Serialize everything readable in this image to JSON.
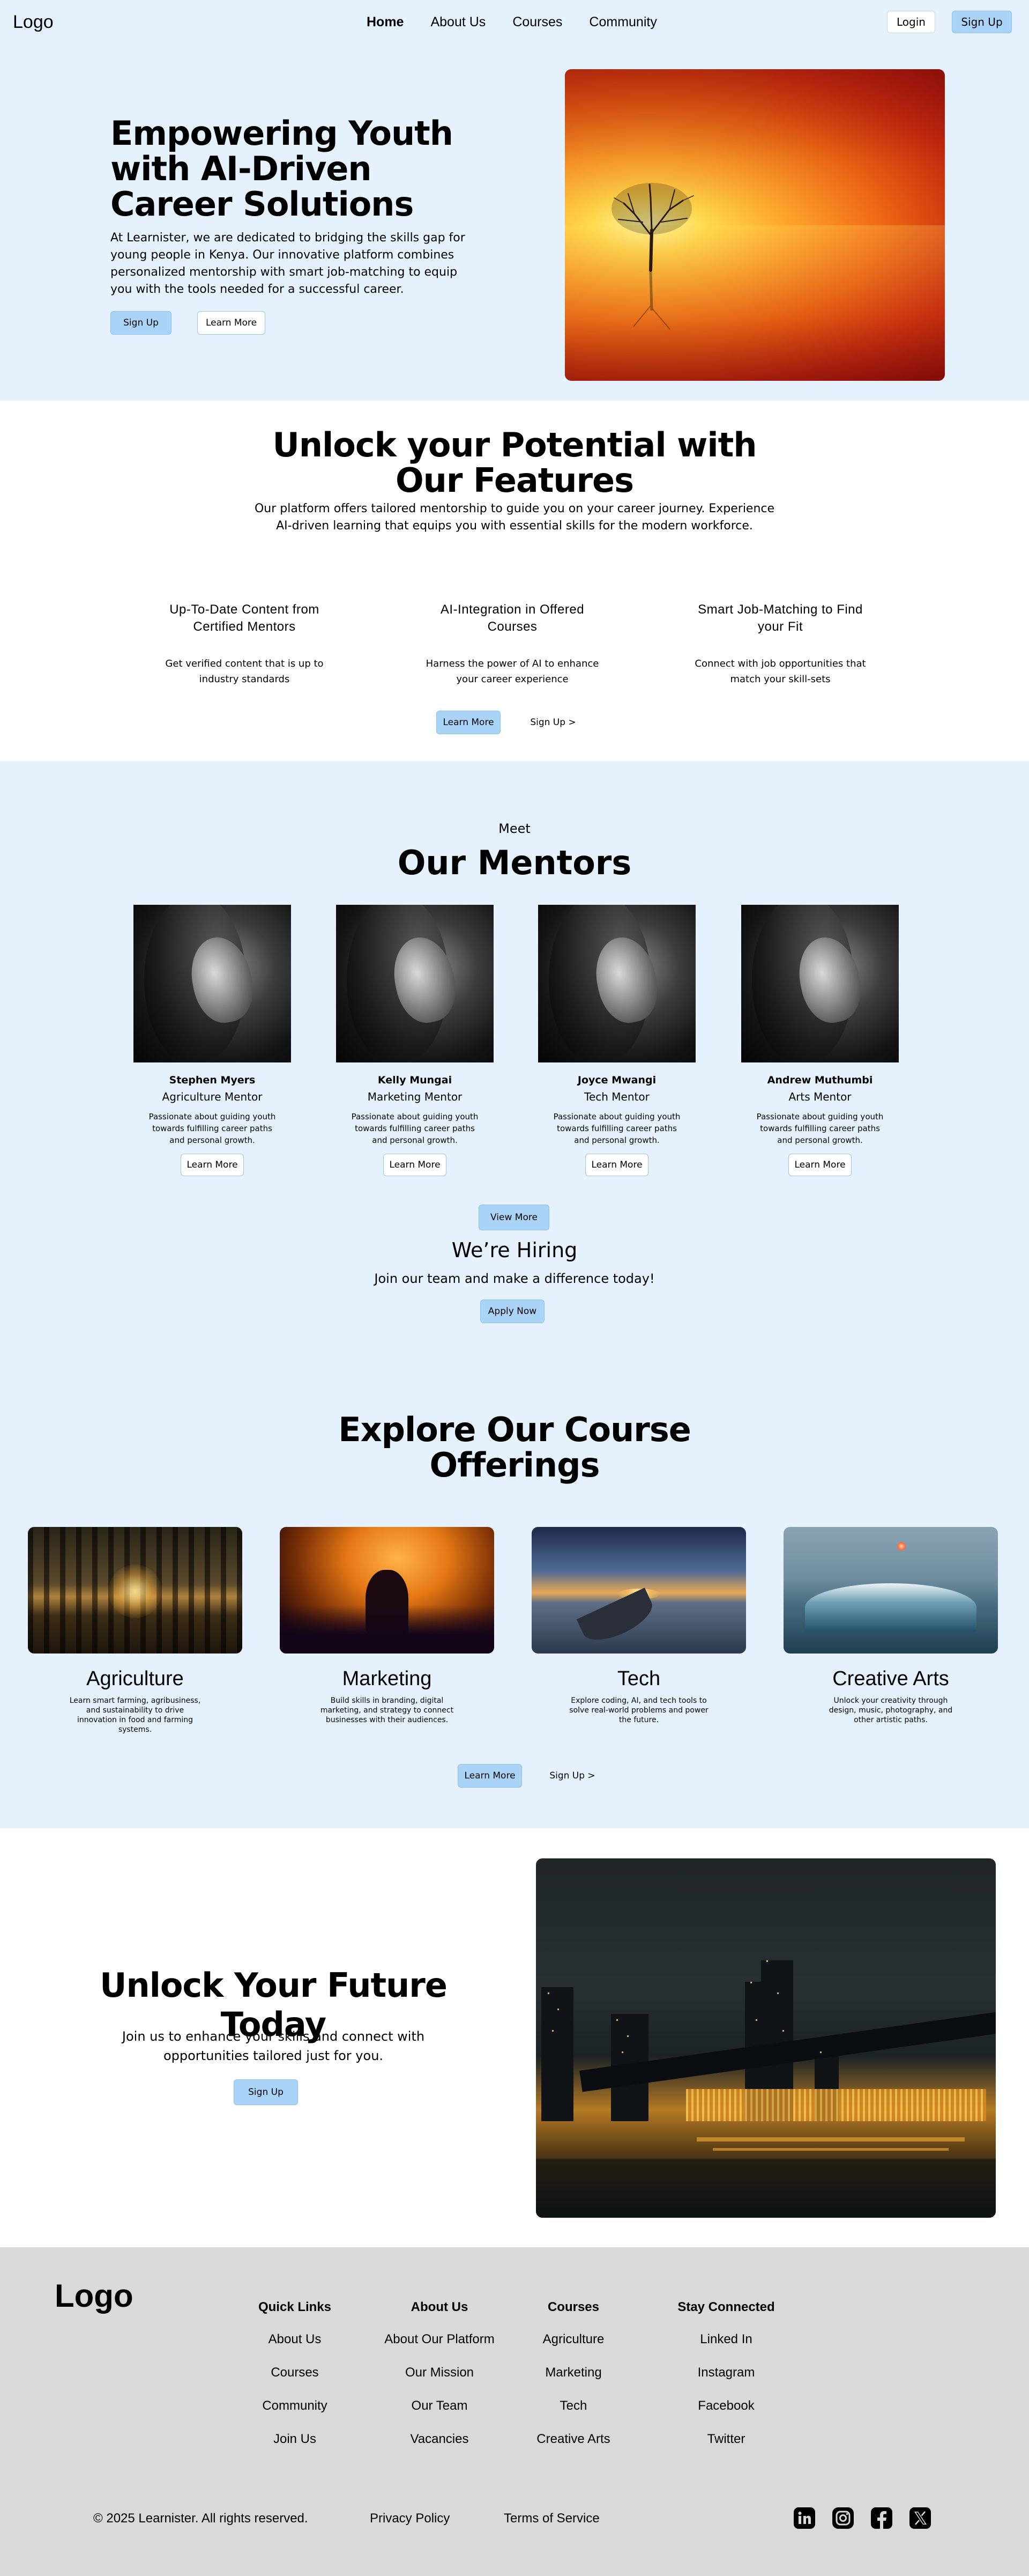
{
  "nav": {
    "logo": "Logo",
    "links": [
      "Home",
      "About Us",
      "Courses",
      "Community"
    ],
    "login": "Login",
    "signup": "Sign Up"
  },
  "hero": {
    "title": "Empowering Youth with AI-Driven Career Solutions",
    "description": "At Learnister, we are dedicated to bridging the skills gap for young people in Kenya. Our innovative platform combines personalized mentorship with smart job-matching to equip you with the tools needed for a successful career.",
    "primary_button": "Sign Up",
    "secondary_button": "Learn More"
  },
  "features": {
    "title": "Unlock your Potential with Our Features",
    "subtitle": "Our platform offers tailored mentorship to guide you on your career journey. Experience AI-driven learning that equips you with essential skills for the modern workforce.",
    "items": [
      {
        "title": "Up-To-Date Content from Certified Mentors",
        "desc": "Get verified content that is up to industry standards"
      },
      {
        "title": "AI-Integration in Offered Courses",
        "desc": "Harness the power of AI to enhance your career experience"
      },
      {
        "title": "Smart Job-Matching to Find your Fit",
        "desc": "Connect with job opportunities that match your skill-sets"
      }
    ],
    "primary_button": "Learn More",
    "secondary_button": "Sign Up  >"
  },
  "mentors": {
    "eyebrow": "Meet",
    "title": "Our Mentors",
    "items": [
      {
        "name": "Stephen Myers",
        "role": "Agriculture Mentor",
        "desc": "Passionate about guiding youth towards fulfilling career paths and personal growth.",
        "button": "Learn More"
      },
      {
        "name": "Kelly Mungai",
        "role": "Marketing Mentor",
        "desc": "Passionate about guiding youth towards fulfilling career paths and personal growth.",
        "button": "Learn More"
      },
      {
        "name": "Joyce Mwangi",
        "role": "Tech Mentor",
        "desc": "Passionate about guiding youth towards fulfilling career paths and personal growth.",
        "button": "Learn More"
      },
      {
        "name": "Andrew Muthumbi",
        "role": "Arts Mentor",
        "desc": "Passionate about guiding youth towards fulfilling career paths and personal growth.",
        "button": "Learn More"
      }
    ],
    "view_more": "View More"
  },
  "hiring": {
    "title": "We’re Hiring",
    "subtitle": "Join our team and make a difference today!",
    "button": "Apply Now"
  },
  "courses": {
    "title": "Explore Our Course Offerings",
    "items": [
      {
        "title": "Agriculture",
        "desc": "Learn smart farming, agribusiness, and sustainability to drive innovation in food and farming systems."
      },
      {
        "title": "Marketing",
        "desc": "Build skills in branding, digital marketing, and strategy to connect businesses with their audiences."
      },
      {
        "title": "Tech",
        "desc": "Explore coding, AI, and tech tools to solve real-world problems and power the future."
      },
      {
        "title": "Creative Arts",
        "desc": "Unlock your creativity through design, music, photography, and other artistic paths."
      }
    ],
    "primary_button": "Learn More",
    "secondary_button": "Sign Up  >"
  },
  "cta": {
    "title": "Unlock Your Future Today",
    "description": "Join us to enhance your skills and connect with opportunities tailored just for you.",
    "button": "Sign Up"
  },
  "footer": {
    "logo": "Logo",
    "columns": [
      {
        "title": "Quick Links",
        "links": [
          "About Us",
          "Courses",
          "Community",
          "Join Us"
        ]
      },
      {
        "title": "About Us",
        "links": [
          "About Our Platform",
          "Our Mission",
          "Our Team",
          "Vacancies"
        ]
      },
      {
        "title": "Courses",
        "links": [
          "Agriculture",
          "Marketing",
          "Tech",
          "Creative Arts"
        ]
      },
      {
        "title": "Stay Connected",
        "links": [
          "Linked In",
          "Instagram",
          "Facebook",
          "Twitter"
        ]
      }
    ],
    "copyright": "© 2025 Learnister. All rights reserved.",
    "privacy": "Privacy Policy",
    "terms": "Terms of Service",
    "social_icons": [
      "linkedin-icon",
      "instagram-icon",
      "facebook-icon",
      "x-icon"
    ]
  }
}
